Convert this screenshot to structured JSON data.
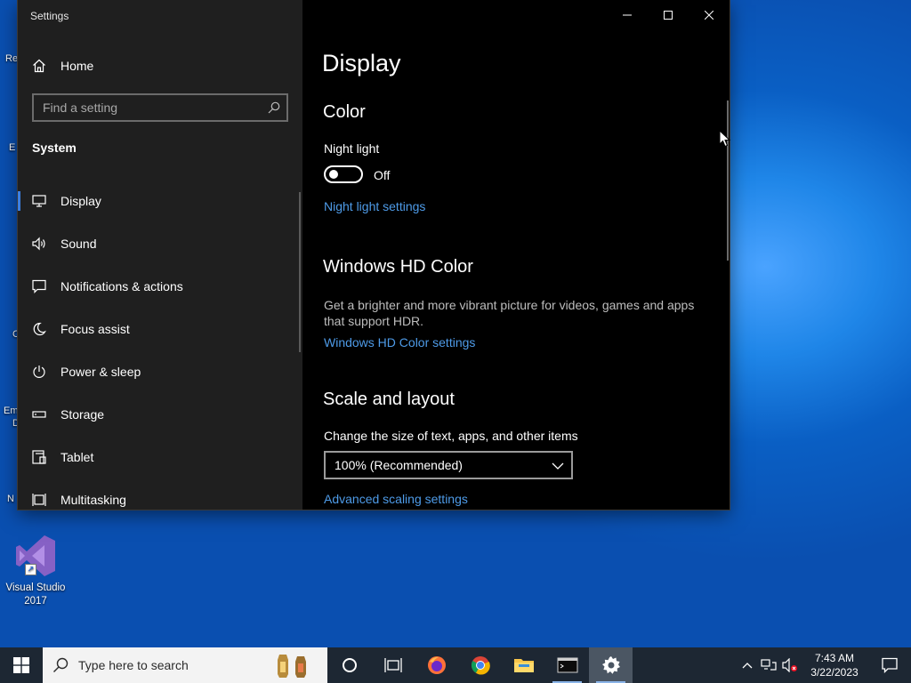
{
  "desktop": {
    "fragments": [
      "Re",
      "E",
      "C",
      "Em",
      "D",
      "N"
    ],
    "vs_icon_label_line1": "Visual Studio",
    "vs_icon_label_line2": "2017"
  },
  "window": {
    "title": "Settings",
    "nav": {
      "home_label": "Home",
      "search_placeholder": "Find a setting",
      "section": "System",
      "items": [
        {
          "label": "Display",
          "icon": "monitor-icon"
        },
        {
          "label": "Sound",
          "icon": "speaker-icon"
        },
        {
          "label": "Notifications & actions",
          "icon": "message-icon"
        },
        {
          "label": "Focus assist",
          "icon": "moon-icon"
        },
        {
          "label": "Power & sleep",
          "icon": "power-icon"
        },
        {
          "label": "Storage",
          "icon": "storage-icon"
        },
        {
          "label": "Tablet",
          "icon": "tablet-icon"
        },
        {
          "label": "Multitasking",
          "icon": "multitasking-icon"
        }
      ]
    },
    "main": {
      "page_title": "Display",
      "color_heading": "Color",
      "night_light_label": "Night light",
      "night_light_state": "Off",
      "night_light_link": "Night light settings",
      "hd_heading": "Windows HD Color",
      "hd_description": "Get a brighter and more vibrant picture for videos, games and apps that support HDR.",
      "hd_link": "Windows HD Color settings",
      "scale_heading": "Scale and layout",
      "scale_label": "Change the size of text, apps, and other items",
      "scale_value": "100% (Recommended)",
      "scale_link": "Advanced scaling settings"
    }
  },
  "taskbar": {
    "search_placeholder": "Type here to search",
    "time": "7:43 AM",
    "date": "3/22/2023",
    "apps": [
      "task-view-icon",
      "firefox-icon",
      "chrome-icon",
      "file-explorer-icon",
      "terminal-icon",
      "settings-gear-icon"
    ]
  },
  "colors": {
    "accent": "#3c7fe0",
    "link": "#4e9be8",
    "nav_bg": "#1f1f1f",
    "main_bg": "#000000",
    "taskbar_bg": "#1d2733"
  }
}
